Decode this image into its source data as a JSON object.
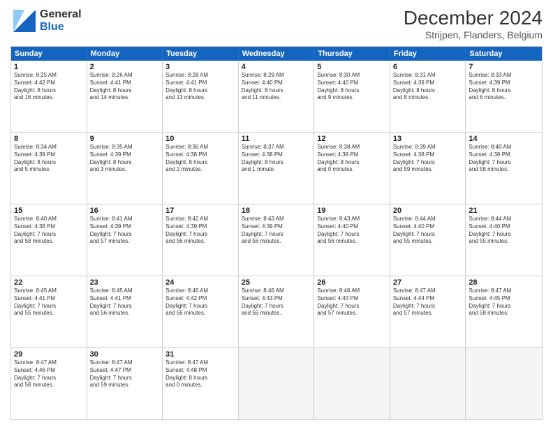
{
  "header": {
    "logo": {
      "general": "General",
      "blue": "Blue"
    },
    "title": "December 2024",
    "subtitle": "Strijpen, Flanders, Belgium"
  },
  "days": [
    "Sunday",
    "Monday",
    "Tuesday",
    "Wednesday",
    "Thursday",
    "Friday",
    "Saturday"
  ],
  "weeks": [
    [
      {
        "day": "1",
        "lines": [
          "Sunrise: 8:25 AM",
          "Sunset: 4:42 PM",
          "Daylight: 8 hours",
          "and 16 minutes."
        ]
      },
      {
        "day": "2",
        "lines": [
          "Sunrise: 8:26 AM",
          "Sunset: 4:41 PM",
          "Daylight: 8 hours",
          "and 14 minutes."
        ]
      },
      {
        "day": "3",
        "lines": [
          "Sunrise: 8:28 AM",
          "Sunset: 4:41 PM",
          "Daylight: 8 hours",
          "and 13 minutes."
        ]
      },
      {
        "day": "4",
        "lines": [
          "Sunrise: 8:29 AM",
          "Sunset: 4:40 PM",
          "Daylight: 8 hours",
          "and 11 minutes."
        ]
      },
      {
        "day": "5",
        "lines": [
          "Sunrise: 8:30 AM",
          "Sunset: 4:40 PM",
          "Daylight: 8 hours",
          "and 9 minutes."
        ]
      },
      {
        "day": "6",
        "lines": [
          "Sunrise: 8:31 AM",
          "Sunset: 4:39 PM",
          "Daylight: 8 hours",
          "and 8 minutes."
        ]
      },
      {
        "day": "7",
        "lines": [
          "Sunrise: 8:33 AM",
          "Sunset: 4:39 PM",
          "Daylight: 8 hours",
          "and 6 minutes."
        ]
      }
    ],
    [
      {
        "day": "8",
        "lines": [
          "Sunrise: 8:34 AM",
          "Sunset: 4:39 PM",
          "Daylight: 8 hours",
          "and 5 minutes."
        ]
      },
      {
        "day": "9",
        "lines": [
          "Sunrise: 8:35 AM",
          "Sunset: 4:39 PM",
          "Daylight: 8 hours",
          "and 3 minutes."
        ]
      },
      {
        "day": "10",
        "lines": [
          "Sunrise: 8:36 AM",
          "Sunset: 4:38 PM",
          "Daylight: 8 hours",
          "and 2 minutes."
        ]
      },
      {
        "day": "11",
        "lines": [
          "Sunrise: 8:37 AM",
          "Sunset: 4:38 PM",
          "Daylight: 8 hours",
          "and 1 minute."
        ]
      },
      {
        "day": "12",
        "lines": [
          "Sunrise: 8:38 AM",
          "Sunset: 4:38 PM",
          "Daylight: 8 hours",
          "and 0 minutes."
        ]
      },
      {
        "day": "13",
        "lines": [
          "Sunrise: 8:39 AM",
          "Sunset: 4:38 PM",
          "Daylight: 7 hours",
          "and 59 minutes."
        ]
      },
      {
        "day": "14",
        "lines": [
          "Sunrise: 8:40 AM",
          "Sunset: 4:38 PM",
          "Daylight: 7 hours",
          "and 58 minutes."
        ]
      }
    ],
    [
      {
        "day": "15",
        "lines": [
          "Sunrise: 8:40 AM",
          "Sunset: 4:38 PM",
          "Daylight: 7 hours",
          "and 58 minutes."
        ]
      },
      {
        "day": "16",
        "lines": [
          "Sunrise: 8:41 AM",
          "Sunset: 4:39 PM",
          "Daylight: 7 hours",
          "and 57 minutes."
        ]
      },
      {
        "day": "17",
        "lines": [
          "Sunrise: 8:42 AM",
          "Sunset: 4:39 PM",
          "Daylight: 7 hours",
          "and 56 minutes."
        ]
      },
      {
        "day": "18",
        "lines": [
          "Sunrise: 8:43 AM",
          "Sunset: 4:39 PM",
          "Daylight: 7 hours",
          "and 56 minutes."
        ]
      },
      {
        "day": "19",
        "lines": [
          "Sunrise: 8:43 AM",
          "Sunset: 4:40 PM",
          "Daylight: 7 hours",
          "and 56 minutes."
        ]
      },
      {
        "day": "20",
        "lines": [
          "Sunrise: 8:44 AM",
          "Sunset: 4:40 PM",
          "Daylight: 7 hours",
          "and 55 minutes."
        ]
      },
      {
        "day": "21",
        "lines": [
          "Sunrise: 8:44 AM",
          "Sunset: 4:40 PM",
          "Daylight: 7 hours",
          "and 55 minutes."
        ]
      }
    ],
    [
      {
        "day": "22",
        "lines": [
          "Sunrise: 8:45 AM",
          "Sunset: 4:41 PM",
          "Daylight: 7 hours",
          "and 55 minutes."
        ]
      },
      {
        "day": "23",
        "lines": [
          "Sunrise: 8:45 AM",
          "Sunset: 4:41 PM",
          "Daylight: 7 hours",
          "and 56 minutes."
        ]
      },
      {
        "day": "24",
        "lines": [
          "Sunrise: 8:46 AM",
          "Sunset: 4:42 PM",
          "Daylight: 7 hours",
          "and 56 minutes."
        ]
      },
      {
        "day": "25",
        "lines": [
          "Sunrise: 8:46 AM",
          "Sunset: 4:43 PM",
          "Daylight: 7 hours",
          "and 56 minutes."
        ]
      },
      {
        "day": "26",
        "lines": [
          "Sunrise: 8:46 AM",
          "Sunset: 4:43 PM",
          "Daylight: 7 hours",
          "and 57 minutes."
        ]
      },
      {
        "day": "27",
        "lines": [
          "Sunrise: 8:47 AM",
          "Sunset: 4:44 PM",
          "Daylight: 7 hours",
          "and 57 minutes."
        ]
      },
      {
        "day": "28",
        "lines": [
          "Sunrise: 8:47 AM",
          "Sunset: 4:45 PM",
          "Daylight: 7 hours",
          "and 58 minutes."
        ]
      }
    ],
    [
      {
        "day": "29",
        "lines": [
          "Sunrise: 8:47 AM",
          "Sunset: 4:46 PM",
          "Daylight: 7 hours",
          "and 58 minutes."
        ]
      },
      {
        "day": "30",
        "lines": [
          "Sunrise: 8:47 AM",
          "Sunset: 4:47 PM",
          "Daylight: 7 hours",
          "and 59 minutes."
        ]
      },
      {
        "day": "31",
        "lines": [
          "Sunrise: 8:47 AM",
          "Sunset: 4:48 PM",
          "Daylight: 8 hours",
          "and 0 minutes."
        ]
      },
      {
        "day": "",
        "lines": []
      },
      {
        "day": "",
        "lines": []
      },
      {
        "day": "",
        "lines": []
      },
      {
        "day": "",
        "lines": []
      }
    ]
  ]
}
